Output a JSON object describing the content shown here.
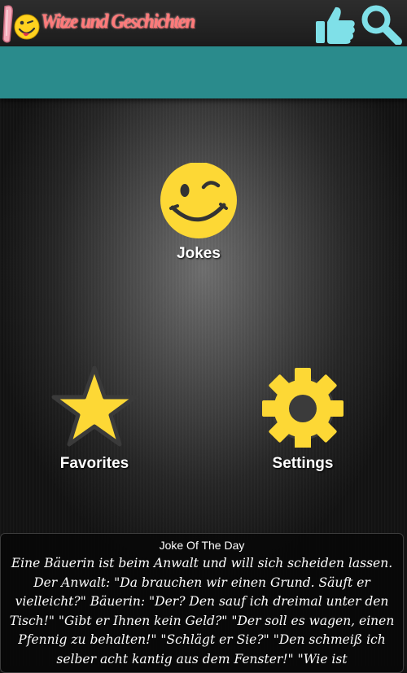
{
  "header": {
    "title": "Witze und Geschichten",
    "logo_icon": "winking-emoji-logo-icon",
    "like_icon": "thumbs-up-icon",
    "search_icon": "search-icon",
    "title_color": "#ff7a7a",
    "teal_bar_color": "#2a8b8c"
  },
  "menu": {
    "jokes_label": "Jokes",
    "jokes_icon": "winking-smiley-icon",
    "favorites_label": "Favorites",
    "favorites_icon": "star-icon",
    "settings_label": "Settings",
    "settings_icon": "gear-icon",
    "icon_color": "#fdd835"
  },
  "joke_of_the_day": {
    "title": "Joke Of The Day",
    "text": "Eine Bäuerin ist beim Anwalt und will sich scheiden lassen. Der Anwalt: \"Da brauchen wir einen Grund. Säuft er vielleicht?\" Bäuerin: \"Der? Den sauf ich dreimal unter den Tisch!\" \"Gibt er Ihnen kein Geld?\" \"Der soll es wagen, einen Pfennig zu behalten!\" \"Schlägt er Sie?\" \"Den schmeiß ich selber acht kantig aus dem Fenster!\" \"Wie ist"
  }
}
